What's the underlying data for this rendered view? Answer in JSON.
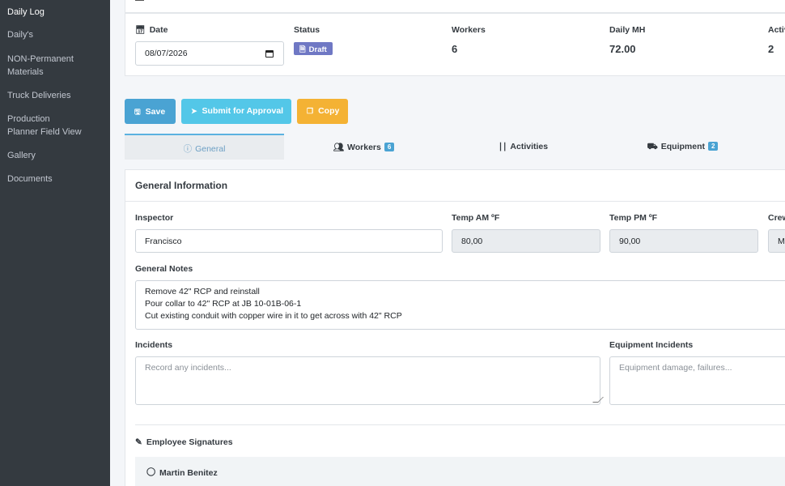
{
  "sidebar": {
    "items": [
      {
        "label": "Daily Log",
        "active": true
      },
      {
        "label": "Daily's"
      },
      {
        "label": "NON-Permanent Materials"
      },
      {
        "label": "Truck Deliveries"
      },
      {
        "label": "Production Planner Field View"
      },
      {
        "label": "Gallery"
      },
      {
        "label": "Documents"
      }
    ]
  },
  "summary": {
    "date_label": "Date",
    "date_value": "08/07/2026",
    "status_label": "Status",
    "status_value": "Draft",
    "workers_label": "Workers",
    "workers_value": "6",
    "mh_label": "Daily MH",
    "mh_value": "72.00",
    "activities_label": "Activ",
    "activities_value": "2"
  },
  "toolbar": {
    "save_label": "Save",
    "submit_label": "Submit for Approval",
    "copy_label": "Copy"
  },
  "tabs": [
    {
      "label": "General",
      "active": true
    },
    {
      "label": "Workers",
      "count": "6"
    },
    {
      "label": "Activities"
    },
    {
      "label": "Equipment",
      "count": "2"
    }
  ],
  "form": {
    "title": "General Information",
    "inspector_label": "Inspector",
    "inspector_value": "Francisco",
    "temp_am_label": "Temp AM ºF",
    "temp_am_value": "80,00",
    "temp_pm_label": "Temp PM ºF",
    "temp_pm_value": "90,00",
    "crew_label": "Crew",
    "crew_value": "Ma",
    "notes_label": "General Notes",
    "notes_lines": [
      "Remove 42\" RCP and reinstall",
      "Pour collar to 42\" RCP at JB 10-01B-06-1",
      "Cut existing conduit with copper wire in it to get across with 42\" RCP"
    ],
    "incidents_label": "Incidents",
    "incidents_placeholder": "Record any incidents...",
    "equip_incidents_label": "Equipment Incidents",
    "equip_incidents_placeholder": "Equipment damage, failures...",
    "signatures_label": "Employee Signatures",
    "signatures": [
      "Martin Benitez"
    ]
  },
  "colors": {
    "sidebar_bg": "#343a40",
    "save": "#4aa3d3",
    "submit": "#53c7e8",
    "copy": "#f4b234",
    "draft_badge": "#6f78c4"
  }
}
